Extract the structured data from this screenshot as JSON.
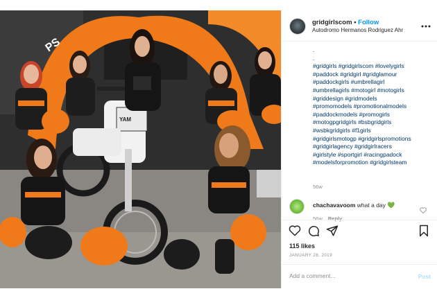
{
  "post": {
    "username": "gridgirlscom",
    "separator": "•",
    "follow_label": "Follow",
    "location": "Autodromo Hermanos Rodriguez Ahr",
    "more_icon": "more-horizontal-icon",
    "caption_dots": [
      ".",
      "."
    ],
    "hashtags": [
      "#gridgirls #gridgirlscom #lovelygirls",
      "#paddock #gridgirl #gridglamour",
      "#paddockgirls #umbrellagirl",
      "#umbrellagirls #motogirl #motogirls",
      "#griddesign #gridmodels",
      "#promomodels #promotionalmodels",
      "#paddockmodels #promogirls",
      "#motogpgridgirls #bsbgridgirls",
      "#wsbkgridgirls #f1girls",
      "#gridgirlsmotogp #gridgirlspromotions",
      "#gridgirlagency #gridgirlracers",
      "#girlstyle #sportgirl #racingpadock",
      "#modelsforpromotion #gridgirlsteam"
    ],
    "caption_time": "56w"
  },
  "comment": {
    "username": "chachavavoom",
    "text": "what a day",
    "emoji": "💚",
    "time": "56w",
    "reply_label": "Reply"
  },
  "actions": {
    "like_icon": "heart-icon",
    "comment_icon": "comment-icon",
    "share_icon": "share-icon",
    "save_icon": "bookmark-icon"
  },
  "likes_text": "115 likes",
  "date_text": "JANUARY 28, 2019",
  "add_comment": {
    "placeholder": "Add a comment...",
    "post_label": "Post"
  },
  "colors": {
    "link_blue": "#0095f6",
    "hashtag_blue": "#00376b",
    "muted_gray": "#8e8e8e",
    "post_disabled": "#b2dffc",
    "orange_accent": "#f07a1a"
  }
}
